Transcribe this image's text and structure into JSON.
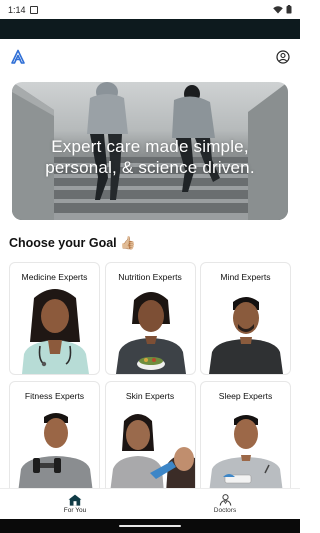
{
  "status_bar": {
    "time": "1:14"
  },
  "hero": {
    "headline_line1": "Expert care made simple,",
    "headline_line2": "personal, & science driven."
  },
  "section": {
    "title": "Choose your Goal",
    "emoji": "👍🏼"
  },
  "goals": [
    {
      "label": "Medicine Experts"
    },
    {
      "label": "Nutrition Experts"
    },
    {
      "label": "Mind Experts"
    },
    {
      "label": "Fitness Experts"
    },
    {
      "label": "Skin Experts"
    },
    {
      "label": "Sleep Experts"
    }
  ],
  "bottom_nav": [
    {
      "label": "For You",
      "icon": "home-icon",
      "active": true
    },
    {
      "label": "Doctors",
      "icon": "doctor-icon",
      "active": false
    }
  ],
  "colors": {
    "top_band": "#0d1a1e",
    "accent": "#0f5f6e",
    "nav_active": "#103b46"
  }
}
